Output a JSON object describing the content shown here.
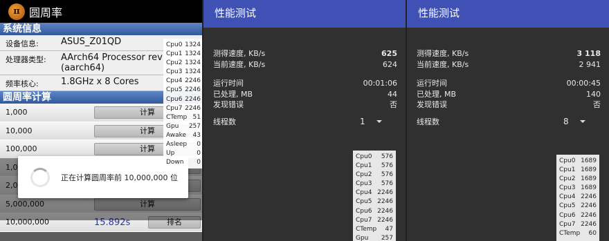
{
  "app": {
    "title": "圆周率",
    "logo_glyph": "π",
    "section_info": "系统信息",
    "info": [
      {
        "key": "设备信息:",
        "value": "ASUS_Z01QD"
      },
      {
        "key": "处理器类型:",
        "value": "AArch64 Processor rev\n(aarch64)"
      },
      {
        "key": "频率核心:",
        "value": "1.8GHz x 8 Cores"
      }
    ],
    "section_calc": "圆周率计算",
    "calc_rows": [
      {
        "label": "1,000",
        "button": "计算"
      },
      {
        "label": "10,000",
        "button": "计算"
      },
      {
        "label": "100,000",
        "button": "计算"
      },
      {
        "label": "1,0",
        "button": "计算"
      },
      {
        "label": "2,0",
        "button": "计算"
      },
      {
        "label": "5,000,000",
        "button": "计算"
      },
      {
        "label": "10,000,000",
        "result": "15.892s",
        "button": "排名"
      }
    ],
    "dialog_text": "正在计算圆周率前 10,000,000 位",
    "stats": [
      {
        "k": "Cpu0",
        "v": "1324"
      },
      {
        "k": "Cpu1",
        "v": "1324"
      },
      {
        "k": "Cpu2",
        "v": "1324"
      },
      {
        "k": "Cpu3",
        "v": "1324"
      },
      {
        "k": "Cpu4",
        "v": "2246"
      },
      {
        "k": "Cpu5",
        "v": "2246"
      },
      {
        "k": "Cpu6",
        "v": "2246"
      },
      {
        "k": "Cpu7",
        "v": "2246"
      },
      {
        "k": "CTemp",
        "v": "51"
      },
      {
        "k": "Gpu",
        "v": "257"
      },
      {
        "k": "Awake",
        "v": "43"
      },
      {
        "k": "Asleep",
        "v": "0"
      },
      {
        "k": "Up",
        "v": "0"
      },
      {
        "k": "Down",
        "v": "0"
      }
    ]
  },
  "bench1": {
    "title": "性能测试",
    "rows": [
      {
        "label": "测得速度, KB/s",
        "value": "625",
        "bold": true
      },
      {
        "label": "当前速度, KB/s",
        "value": "624"
      }
    ],
    "rows2": [
      {
        "label": "运行时间",
        "value": "00:01:06"
      },
      {
        "label": "已处理, MB",
        "value": "44"
      },
      {
        "label": "发现错误",
        "value": "否"
      }
    ],
    "threads_label": "线程数",
    "threads_value": "1",
    "stats": [
      {
        "k": "Cpu0",
        "v": "576"
      },
      {
        "k": "Cpu1",
        "v": "576"
      },
      {
        "k": "Cpu2",
        "v": "576"
      },
      {
        "k": "Cpu3",
        "v": "576"
      },
      {
        "k": "Cpu4",
        "v": "2246"
      },
      {
        "k": "Cpu5",
        "v": "2246"
      },
      {
        "k": "Cpu6",
        "v": "2246"
      },
      {
        "k": "Cpu7",
        "v": "2246"
      },
      {
        "k": "CTemp",
        "v": "47"
      },
      {
        "k": "Gpu",
        "v": "257"
      }
    ]
  },
  "bench2": {
    "title": "性能测试",
    "rows": [
      {
        "label": "测得速度, KB/s",
        "value": "3 118",
        "bold": true
      },
      {
        "label": "当前速度, KB/s",
        "value": "2 941"
      }
    ],
    "rows2": [
      {
        "label": "运行时间",
        "value": "00:00:45"
      },
      {
        "label": "已处理, MB",
        "value": "140"
      },
      {
        "label": "发现错误",
        "value": "否"
      }
    ],
    "threads_label": "线程数",
    "threads_value": "8",
    "stats": [
      {
        "k": "Cpu0",
        "v": "1689"
      },
      {
        "k": "Cpu1",
        "v": "1689"
      },
      {
        "k": "Cpu2",
        "v": "1689"
      },
      {
        "k": "Cpu3",
        "v": "1689"
      },
      {
        "k": "Cpu4",
        "v": "2246"
      },
      {
        "k": "Cpu5",
        "v": "2246"
      },
      {
        "k": "Cpu6",
        "v": "2246"
      },
      {
        "k": "Cpu7",
        "v": "2246"
      },
      {
        "k": "CTemp",
        "v": "60"
      }
    ]
  },
  "colors": {
    "app_bar": "#3f51b5",
    "section_header": "#3d63a8",
    "result_text": "#2a3ab0"
  }
}
